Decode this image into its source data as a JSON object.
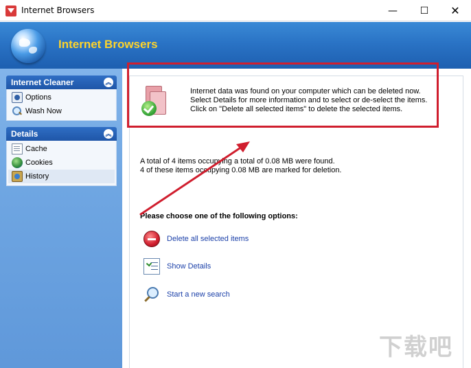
{
  "window": {
    "title": "Internet Browsers",
    "controls": {
      "minimize": "—",
      "maximize": "☐",
      "close": "✕"
    }
  },
  "banner": {
    "title": "Internet Browsers"
  },
  "sidebar": {
    "panels": [
      {
        "title": "Internet Cleaner",
        "items": [
          {
            "label": "Options",
            "icon": "options-icon"
          },
          {
            "label": "Wash Now",
            "icon": "wash-now-icon"
          }
        ]
      },
      {
        "title": "Details",
        "items": [
          {
            "label": "Cache",
            "icon": "cache-icon"
          },
          {
            "label": "Cookies",
            "icon": "cookies-icon"
          },
          {
            "label": "History",
            "icon": "history-icon",
            "selected": true
          }
        ]
      }
    ],
    "collapse_glyph": "︽"
  },
  "main": {
    "info": {
      "line1": "Internet data was found on your computer which can be deleted now.",
      "line2": "Select Details for more information and to select or de-select the items.",
      "line3": "Click on \"Delete all selected items\" to delete the selected items."
    },
    "totals": {
      "line1": "A total of 4 items occupying a total of 0.08 MB were found.",
      "line2": "4 of these items occupying 0.08 MB are marked for deletion."
    },
    "choose_label": "Please choose one of the following options:",
    "options": [
      {
        "label": "Delete all selected items",
        "icon": "delete-icon"
      },
      {
        "label": "Show Details",
        "icon": "details-list-icon"
      },
      {
        "label": "Start a new search",
        "icon": "magnifier-icon"
      }
    ]
  },
  "annotation": {
    "highlight_color": "#d01e2e"
  },
  "watermark": {
    "text": "下载吧"
  }
}
